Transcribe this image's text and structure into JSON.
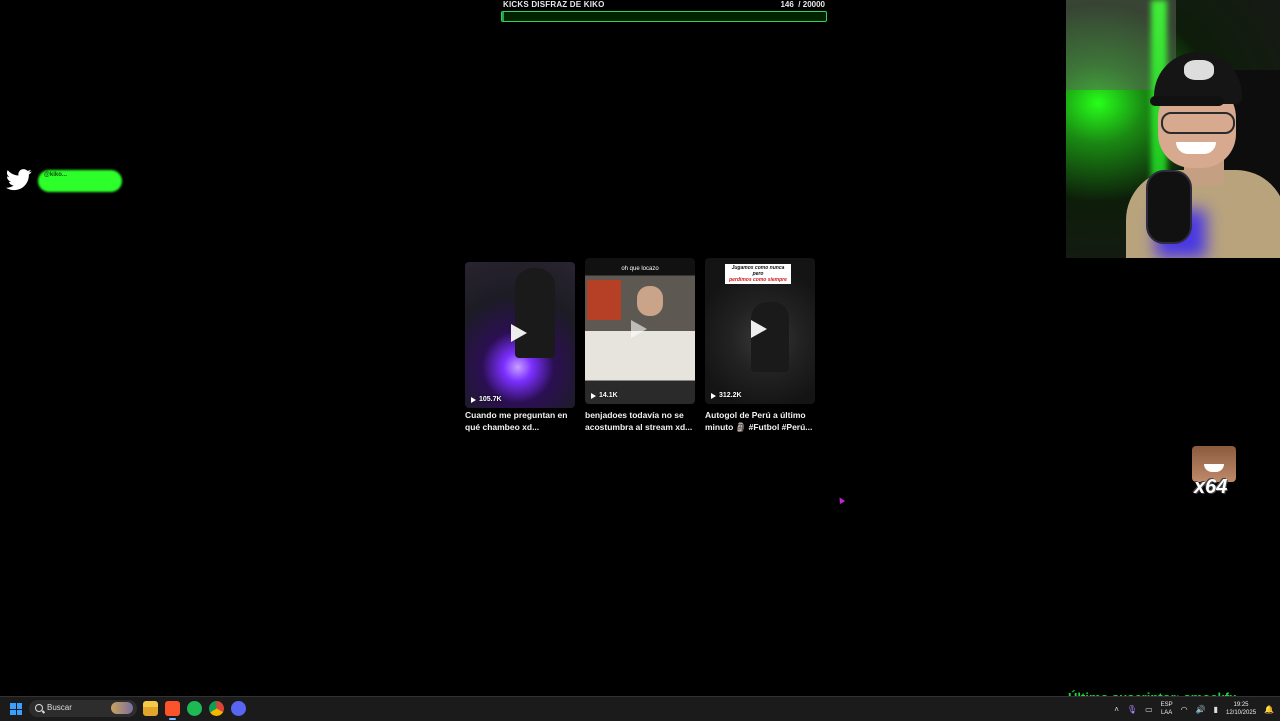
{
  "goal": {
    "title": "KICKS DISFRAZ DE KIKO",
    "current": "146",
    "target": "/ 20000",
    "progress_fraction": 0.0073,
    "bar_color": "#2fd35a"
  },
  "twitter": {
    "handle": "@kiko...",
    "sub": ""
  },
  "videos": [
    {
      "views": "105.7K",
      "title": "Cuando me preguntan en qué chambeo xd...",
      "overlay": ""
    },
    {
      "views": "14.1K",
      "title": "benjadoes todavía no se acostumbra al stream xd...",
      "overlay": "oh que locazo"
    },
    {
      "views": "312.2K",
      "title": "Autogol de Perú a último minuto 🗿 #Futbol #Perú...",
      "overlay_line1": "Jugamos como nunca pero",
      "overlay_line2": "perdimos como siempre"
    }
  ],
  "emote": {
    "count": "x64"
  },
  "last_subscriber": {
    "label": "Último suscriptor: smockfx",
    "color": "#21d33f"
  },
  "taskbar": {
    "search_placeholder": "Buscar",
    "lang_top": "ESP",
    "lang_bottom": "LAA",
    "time": "19:25",
    "date": "12/10/2025",
    "apps": [
      "file-explorer-icon",
      "brave-browser-icon",
      "spotify-icon",
      "chrome-icon",
      "discord-icon"
    ]
  }
}
